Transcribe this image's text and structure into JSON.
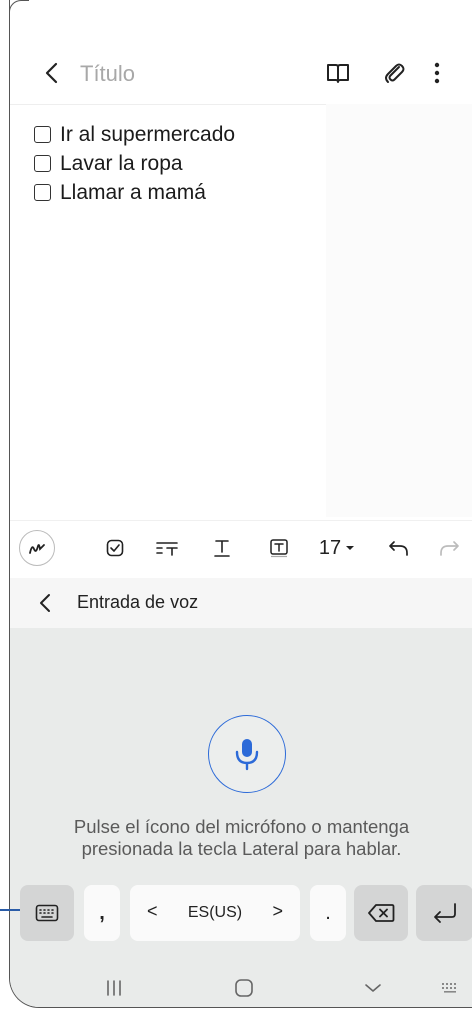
{
  "header": {
    "title_placeholder": "Título",
    "back_icon": "chevron-left-icon",
    "book_icon": "book-icon",
    "attach_icon": "paperclip-icon",
    "more_icon": "more-vertical-icon"
  },
  "note": {
    "items": [
      {
        "label": "Ir al supermercado",
        "checked": false
      },
      {
        "label": "Lavar la ropa",
        "checked": false
      },
      {
        "label": "Llamar a mamá",
        "checked": false
      }
    ]
  },
  "toolbar": {
    "pen_icon": "handwriting-pen-icon",
    "checkbox_icon": "checkbox-icon",
    "paragraph_icon": "paragraph-format-icon",
    "text_style_icon": "text-style-icon",
    "text_box_icon": "text-box-icon",
    "font_size": "17",
    "undo_icon": "undo-icon",
    "redo_icon": "redo-icon"
  },
  "voice_bar": {
    "label": "Entrada de voz"
  },
  "voice_panel": {
    "hint_line1": "Pulse el ícono del micrófono o mantenga",
    "hint_line2": "presionada la tecla Lateral para hablar.",
    "accent": "#2c6ad8"
  },
  "keys": {
    "comma": ",",
    "lang_prev": "<",
    "language": "ES(US)",
    "lang_next": ">",
    "period": "."
  },
  "colors": {
    "panel_bg": "#e9ebea",
    "callout": "#2a5ca8"
  }
}
